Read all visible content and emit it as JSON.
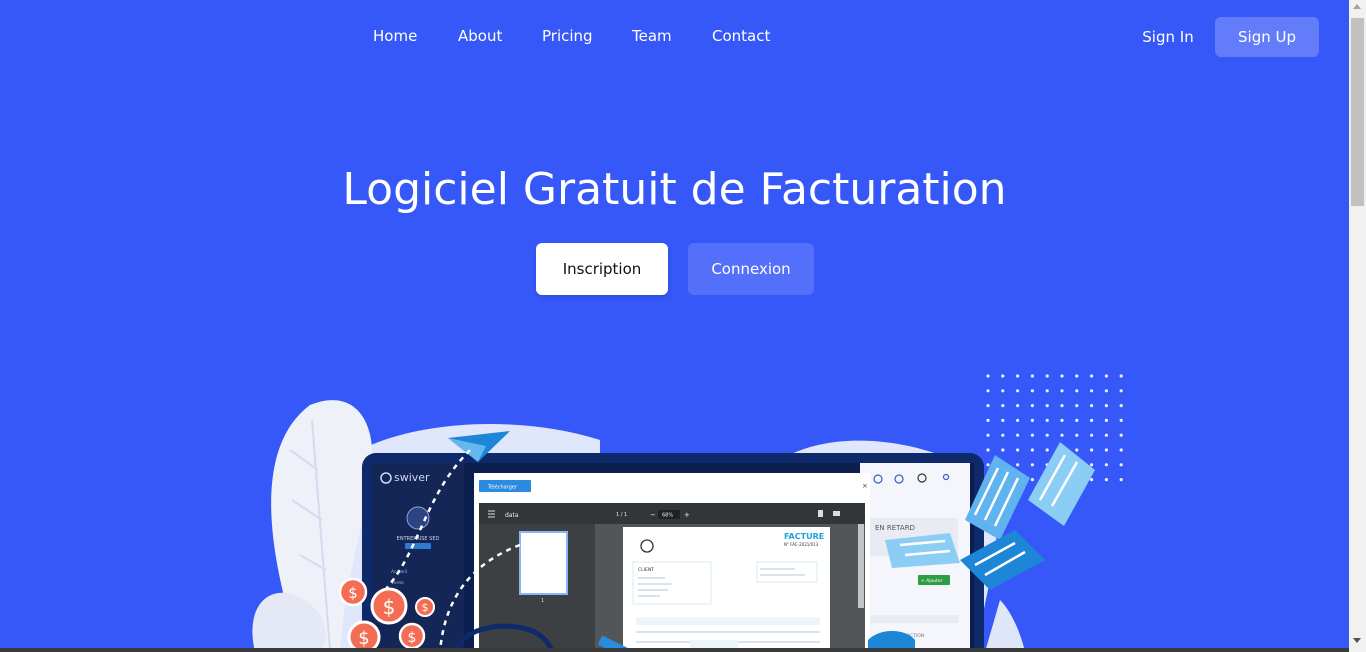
{
  "nav": {
    "links": [
      "Home",
      "About",
      "Pricing",
      "Team",
      "Contact"
    ],
    "sign_in": "Sign In",
    "sign_up": "Sign Up"
  },
  "hero": {
    "title": "Logiciel Gratuit de Facturation",
    "primary_button": "Inscription",
    "secondary_button": "Connexion"
  },
  "mockup": {
    "app_logo": "swiver",
    "company_name": "ENTREPRISE SED",
    "sidebar_items": [
      "Accueil",
      "Vente"
    ],
    "download_button": "Télécharger",
    "viewer_file": "data",
    "page_indicator": "1 / 1",
    "zoom": "68%",
    "invoice_title": "FACTURE",
    "invoice_number": "N° FAC-2021/013",
    "client_label": "CLIENT",
    "late_label": "EN RETARD",
    "add_label": "+ Ajouter",
    "action_label": "ACTION"
  },
  "colors": {
    "background": "#3758f9",
    "white": "#ffffff",
    "accent_light": "#8ec5f5",
    "laptop": "#0e2a6b"
  }
}
